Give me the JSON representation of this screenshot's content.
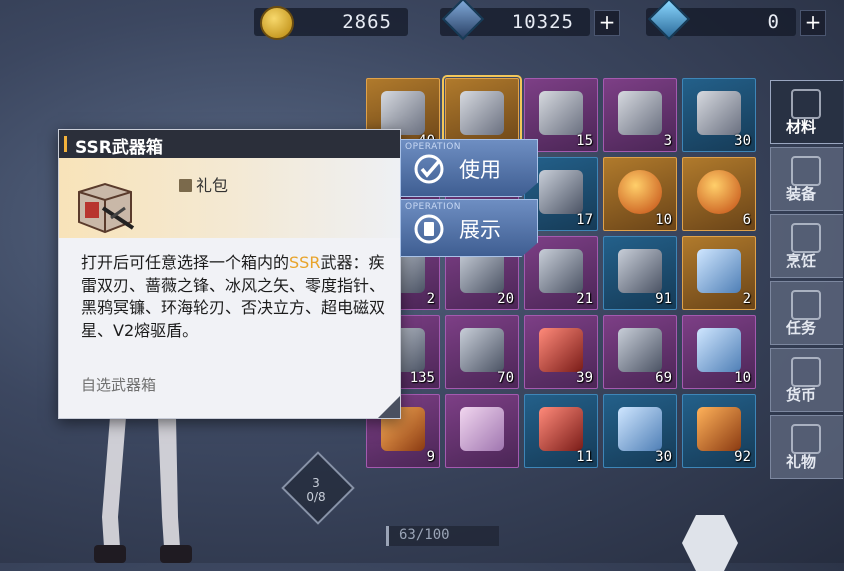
{
  "currency": {
    "gold": {
      "value": "2865",
      "icon": "gold-coin-icon"
    },
    "crystal": {
      "value": "10325",
      "icon": "crystal-cube-icon",
      "plus": "+"
    },
    "gem": {
      "value": "0",
      "icon": "blue-gem-icon",
      "plus": "+"
    }
  },
  "tooltip": {
    "title": "SSR武器箱",
    "type": "礼包",
    "desc_prefix": "打开后可任意选择一个箱内的",
    "desc_highlight": "SSR",
    "desc_suffix": "武器：疾雷双刃、蔷薇之锋、冰风之矢、零度指针、黑鸦冥镰、环海轮刃、否决立方、超电磁双星、V2熔驱盾。",
    "category": "自选武器箱"
  },
  "actions": {
    "tag": "OPERATION",
    "use": "使用",
    "show": "展示"
  },
  "sidebar": {
    "items": [
      {
        "label": "材料",
        "icon": "materials-icon",
        "active": true
      },
      {
        "label": "装备",
        "icon": "equipment-icon",
        "active": false
      },
      {
        "label": "烹饪",
        "icon": "cooking-icon",
        "active": false
      },
      {
        "label": "任务",
        "icon": "quest-icon",
        "active": false
      },
      {
        "label": "货币",
        "icon": "currency-icon",
        "active": false
      },
      {
        "label": "礼物",
        "icon": "gift-icon",
        "active": false
      }
    ]
  },
  "inventory": {
    "rows": [
      [
        {
          "count": "40",
          "tier": "gold",
          "item": "weapon-box"
        },
        {
          "count": "",
          "tier": "gold",
          "item": "weapon-box"
        },
        {
          "count": "15",
          "tier": "purple",
          "item": "weapon-crate"
        },
        {
          "count": "3",
          "tier": "purple",
          "item": "weapon-crate"
        },
        {
          "count": "30",
          "tier": "blue",
          "item": "weapon-crate"
        }
      ],
      [
        {
          "count": "",
          "tier": "purple",
          "item": "hidden"
        },
        {
          "count": "",
          "tier": "purple",
          "item": "hidden"
        },
        {
          "count": "17",
          "tier": "blue",
          "item": "cube-chip"
        },
        {
          "count": "10",
          "tier": "gold",
          "item": "orange-orb"
        },
        {
          "count": "6",
          "tier": "gold",
          "item": "red-orb"
        }
      ],
      [
        {
          "count": "2",
          "tier": "purple",
          "item": "purple-shard"
        },
        {
          "count": "20",
          "tier": "purple",
          "item": "battery-can"
        },
        {
          "count": "21",
          "tier": "purple",
          "item": "chip-card"
        },
        {
          "count": "91",
          "tier": "blue",
          "item": "chip-card"
        },
        {
          "count": "2",
          "tier": "gold",
          "item": "core-device"
        }
      ],
      [
        {
          "count": "135",
          "tier": "purple",
          "item": "ring-core"
        },
        {
          "count": "70",
          "tier": "purple",
          "item": "ring-core"
        },
        {
          "count": "39",
          "tier": "purple",
          "item": "red-core"
        },
        {
          "count": "69",
          "tier": "purple",
          "item": "yellow-ring"
        },
        {
          "count": "10",
          "tier": "purple",
          "item": "ice-crystal"
        }
      ],
      [
        {
          "count": "9",
          "tier": "purple",
          "item": "amber-ore"
        },
        {
          "count": "",
          "tier": "purple",
          "item": "pink-crystal"
        },
        {
          "count": "11",
          "tier": "blue",
          "item": "red-gem"
        },
        {
          "count": "30",
          "tier": "blue",
          "item": "blue-gem"
        },
        {
          "count": "92",
          "tier": "blue",
          "item": "amber-ore"
        }
      ]
    ]
  },
  "hud": {
    "stage": "3",
    "stage_progress": "0/8",
    "energy": "63/100"
  },
  "colors": {
    "highlight": "#e8a42b",
    "gold_tier": "#b07a2c",
    "purple_tier": "#7d3f86",
    "blue_tier": "#23608a",
    "button": "#5575aa"
  }
}
